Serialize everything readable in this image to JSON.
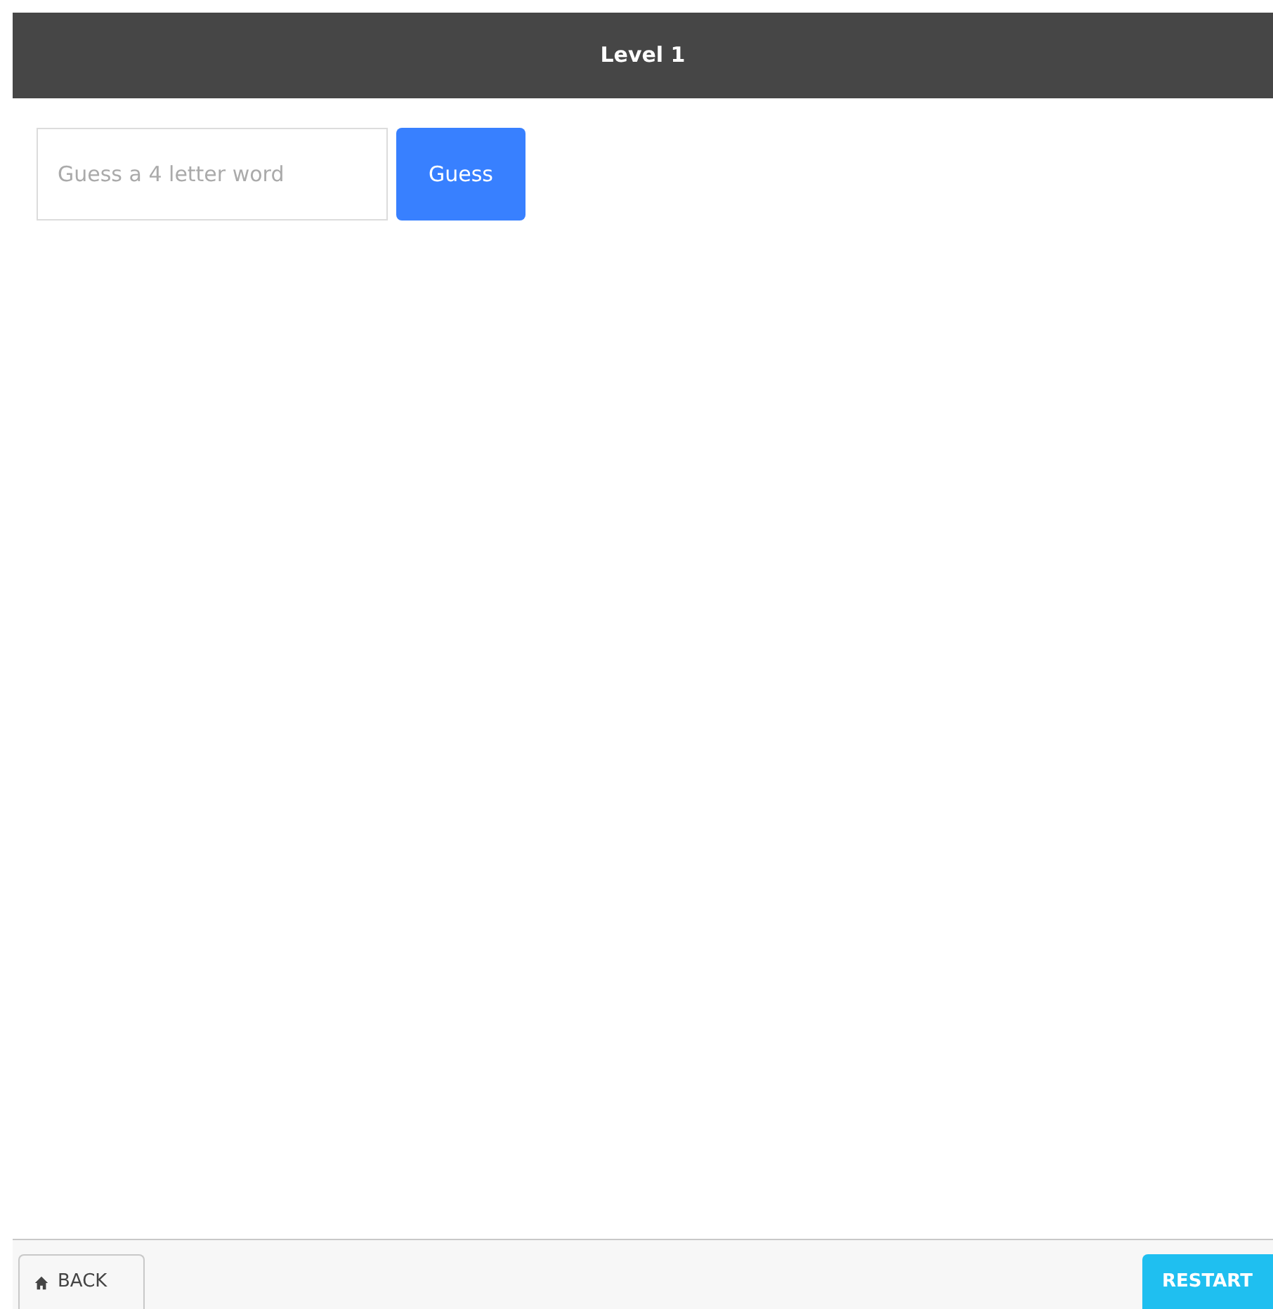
{
  "header": {
    "title": "Level 1"
  },
  "guess_form": {
    "placeholder": "Guess a 4 letter word",
    "button": "Guess"
  },
  "footer": {
    "back_button": "BACK",
    "restart_button": "RESTART"
  }
}
